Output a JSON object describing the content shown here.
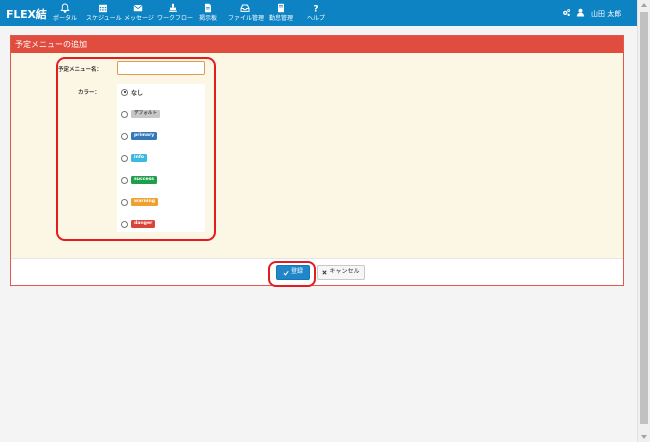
{
  "app": {
    "brand": "FLEX結"
  },
  "nav": {
    "items": [
      {
        "label": "ポータル",
        "icon": "bell-icon"
      },
      {
        "label": "スケジュール",
        "icon": "calendar-icon"
      },
      {
        "label": "メッセージ",
        "icon": "envelope-icon"
      },
      {
        "label": "ワークフロー",
        "icon": "stamp-icon"
      },
      {
        "label": "掲示板",
        "icon": "document-icon"
      },
      {
        "label": "ファイル管理",
        "icon": "inbox-icon"
      },
      {
        "label": "勤怠管理",
        "icon": "notebook-icon"
      },
      {
        "label": "ヘルプ",
        "icon": "question-icon"
      }
    ],
    "user": {
      "name": "山田 太郎",
      "settings_icon": "gears-icon",
      "avatar_icon": "user-icon"
    }
  },
  "panel": {
    "title": "予定メニューの追加",
    "form": {
      "name_label": "予定メニュー名：",
      "name_value": "",
      "color_label": "カラー：",
      "colors": [
        {
          "label": "なし",
          "badge": false,
          "color": "",
          "checked": true
        },
        {
          "label": "デフォルト",
          "badge": true,
          "color": "#c7c7c7",
          "checked": false
        },
        {
          "label": "primary",
          "badge": true,
          "color": "#3478b8",
          "checked": false
        },
        {
          "label": "info",
          "badge": true,
          "color": "#3bb9e0",
          "checked": false
        },
        {
          "label": "success",
          "badge": true,
          "color": "#1f9f4d",
          "checked": false
        },
        {
          "label": "warning",
          "badge": true,
          "color": "#f0a030",
          "checked": false
        },
        {
          "label": "danger",
          "badge": true,
          "color": "#d9453b",
          "checked": false
        }
      ]
    },
    "footer": {
      "save_label": "登録",
      "cancel_label": "キャンセル"
    }
  },
  "colors": {
    "navbar": "#0e83c4",
    "panel_header": "#e04c3e",
    "panel_body": "#fcf7e4",
    "highlight": "#e41c22"
  }
}
